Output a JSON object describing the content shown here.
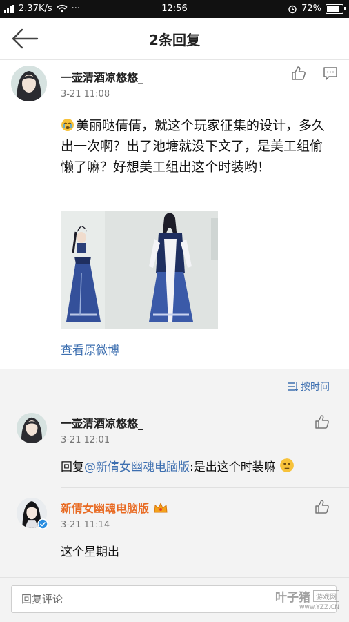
{
  "status_bar": {
    "network": "4G",
    "speed": "2.37K/s",
    "time": "12:56",
    "battery": "72%",
    "battery_level": 0.72
  },
  "header": {
    "title": "2条回复"
  },
  "post": {
    "author": "一壶清酒凉悠悠_",
    "time": "3-21 11:08",
    "content": "美丽哒倩倩，就这个玩家征集的设计，多久出一次啊？出了池塘就没下文了，是美工组偷懒了嘛？好想美工组出这个时装哟！",
    "content_emoji": "crying-face",
    "view_link": "查看原微博"
  },
  "sort": {
    "label": "按时间"
  },
  "replies": [
    {
      "author": "一壶清酒凉悠悠_",
      "time": "3-21 12:01",
      "text_prefix": "回复",
      "mention": "@新倩女幽魂电脑版",
      "text": ":是出这个时装嘛"
    },
    {
      "author": "新倩女幽魂电脑版",
      "time": "3-21 11:14",
      "text": "这个星期出",
      "verified": true
    }
  ],
  "input": {
    "placeholder": "回复评论"
  },
  "watermark": {
    "brand": "叶子猪",
    "tag": "游戏网",
    "url": "www.YZZ.CN"
  },
  "colors": {
    "link": "#3d6fb0",
    "official_name": "#e86a22",
    "section_bg": "#f3f3f3"
  }
}
